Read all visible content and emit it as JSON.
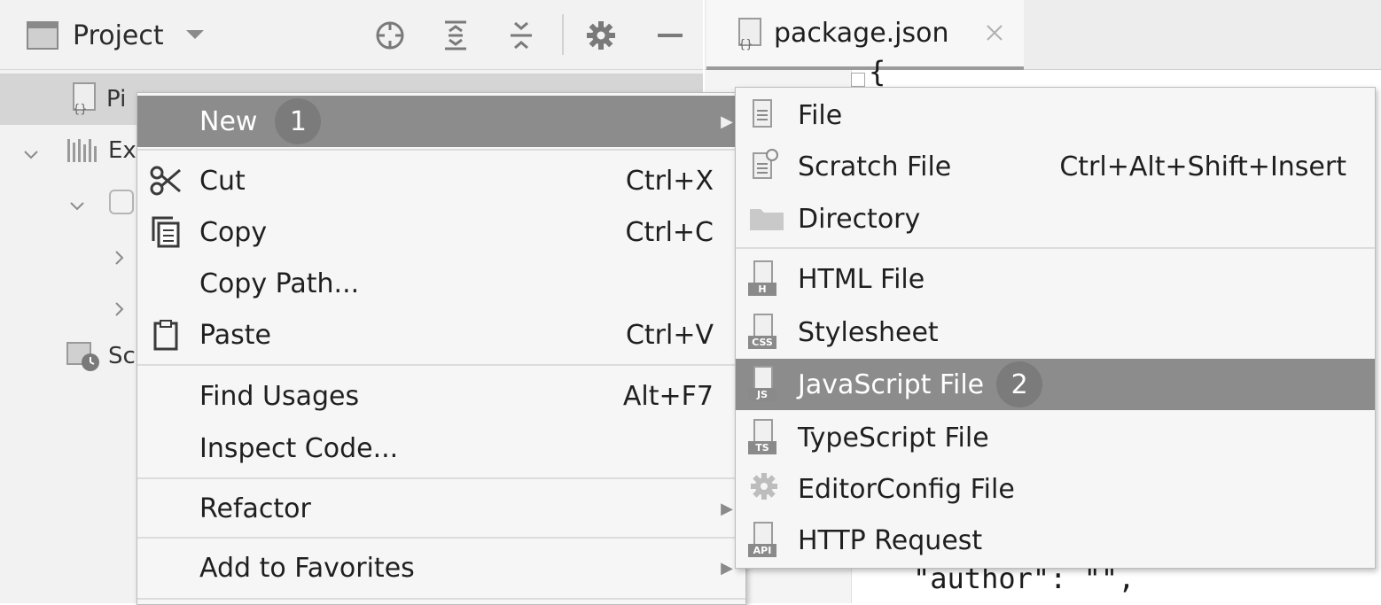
{
  "project_panel": {
    "title": "Project",
    "tree": [
      {
        "label": "Pi",
        "expanded": null
      },
      {
        "label": "Ex",
        "expanded": true
      },
      {
        "label": "",
        "expanded": true
      },
      {
        "label": "",
        "expanded": false
      },
      {
        "label": "",
        "expanded": false
      },
      {
        "label": "Sc",
        "expanded": null
      }
    ]
  },
  "editor": {
    "tab_label": "package.json",
    "code_top": "{",
    "code_bottom": "\"author\": \"\","
  },
  "context_menu": {
    "items": [
      {
        "label": "New",
        "badge": "1",
        "shortcut": "",
        "icon": "",
        "submenu": true,
        "selected": true
      },
      {
        "label": "Cut",
        "shortcut": "Ctrl+X",
        "icon": "scissors-icon"
      },
      {
        "label": "Copy",
        "shortcut": "Ctrl+C",
        "icon": "copy-icon"
      },
      {
        "label": "Copy Path...",
        "shortcut": "",
        "icon": ""
      },
      {
        "label": "Paste",
        "shortcut": "Ctrl+V",
        "icon": "clipboard-icon"
      },
      {
        "label": "Find Usages",
        "shortcut": "Alt+F7",
        "icon": ""
      },
      {
        "label": "Inspect Code...",
        "shortcut": "",
        "icon": ""
      },
      {
        "label": "Refactor",
        "shortcut": "",
        "icon": "",
        "submenu": true
      },
      {
        "label": "Add to Favorites",
        "shortcut": "",
        "icon": "",
        "submenu": true
      }
    ]
  },
  "new_submenu": {
    "items": [
      {
        "label": "File",
        "shortcut": "",
        "icon": "text-file-icon"
      },
      {
        "label": "Scratch File",
        "shortcut": "Ctrl+Alt+Shift+Insert",
        "icon": "scratch-file-icon"
      },
      {
        "label": "Directory",
        "shortcut": "",
        "icon": "folder-icon"
      },
      {
        "label": "HTML File",
        "shortcut": "",
        "icon": "html-file-icon",
        "tag": "H"
      },
      {
        "label": "Stylesheet",
        "shortcut": "",
        "icon": "css-file-icon",
        "tag": "CSS"
      },
      {
        "label": "JavaScript File",
        "badge": "2",
        "shortcut": "",
        "icon": "js-file-icon",
        "tag": "JS",
        "selected": true
      },
      {
        "label": "TypeScript File",
        "shortcut": "",
        "icon": "ts-file-icon",
        "tag": "TS"
      },
      {
        "label": "EditorConfig File",
        "shortcut": "",
        "icon": "editorconfig-icon"
      },
      {
        "label": "HTTP Request",
        "shortcut": "",
        "icon": "http-request-icon",
        "tag": "API"
      }
    ]
  },
  "colors": {
    "selection": "#8c8c8c",
    "badge": "#7b7b7b",
    "panel_bg": "#f2f2f2",
    "menu_bg": "#f6f6f6"
  }
}
